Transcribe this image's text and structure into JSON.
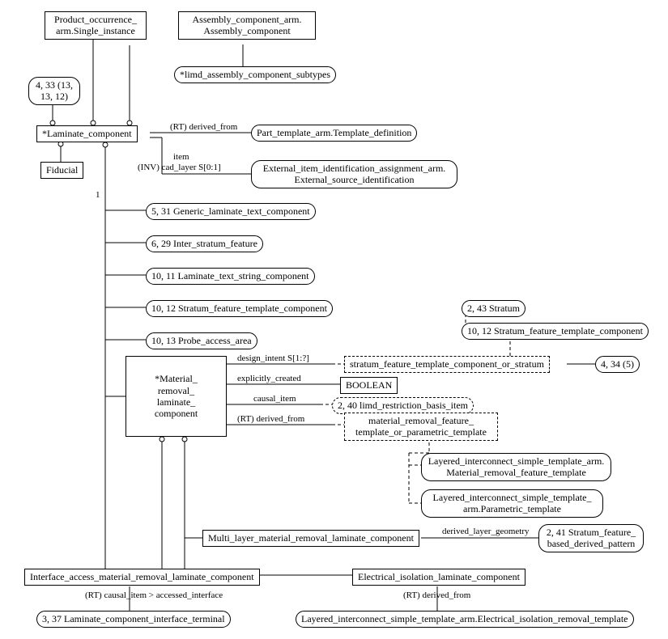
{
  "top": {
    "product_occurrence": "Product_occurrence_\narm.Single_instance",
    "assembly_component": "Assembly_component_arm.\nAssembly_component",
    "limd_subtypes": "*limd_assembly_component_subtypes",
    "page_ref_1": "4, 33 (13,\n13, 12)"
  },
  "laminate": {
    "name": "*Laminate_component",
    "fiducial": "Fiducial",
    "derived_from_label": "(RT) derived_from",
    "template_def": "Part_template_arm.Template_definition",
    "item_label": "item",
    "inv_cad_layer": "(INV) cad_layer S[0:1]",
    "ext_source": "External_item_identification_assignment_arm.\nExternal_source_identification",
    "cardinality_1": "1"
  },
  "subs": [
    "5, 31 Generic_laminate_text_component",
    "6, 29 Inter_stratum_feature",
    "10, 11 Laminate_text_string_component",
    "10, 12 Stratum_feature_template_component",
    "10, 13 Probe_access_area"
  ],
  "mrlc": {
    "name": "*Material_\nremoval_\nlaminate_\ncomponent",
    "design_intent": "design_intent S[1:?]",
    "explicitly_created": "explicitly_created",
    "boolean": "BOOLEAN",
    "causal_item": "causal_item",
    "causal_target": "2, 40 limd_restriction_basis_item",
    "derived_from": "(RT) derived_from",
    "sel_sftc_or_stratum": "stratum_feature_template_component_or_stratum",
    "sel_sftc_ref": "4, 34 (5)",
    "stratum": "2, 43 Stratum",
    "sftc": "10, 12 Stratum_feature_template_component",
    "sel_mrft_or_param": "material_removal_feature_\ntemplate_or_parametric_template",
    "mrft": "Layered_interconnect_simple_template_arm.\nMaterial_removal_feature_template",
    "param_tmpl": "Layered_interconnect_simple_template_\narm.Parametric_template"
  },
  "bottom": {
    "multi_layer": "Multi_layer_material_removal_laminate_component",
    "derived_layer_geom": "derived_layer_geometry",
    "sfbdp": "2, 41 Stratum_feature_\nbased_derived_pattern",
    "interface_access": "Interface_access_material_removal_laminate_component",
    "rt_causal_accessed": "(RT) causal_item > accessed_interface",
    "lcit": "3, 37 Laminate_component_interface_terminal",
    "elec_iso": "Electrical_isolation_laminate_component",
    "rt_derived_from": "(RT) derived_from",
    "eirt": "Layered_interconnect_simple_template_arm.Electrical_isolation_removal_template"
  }
}
